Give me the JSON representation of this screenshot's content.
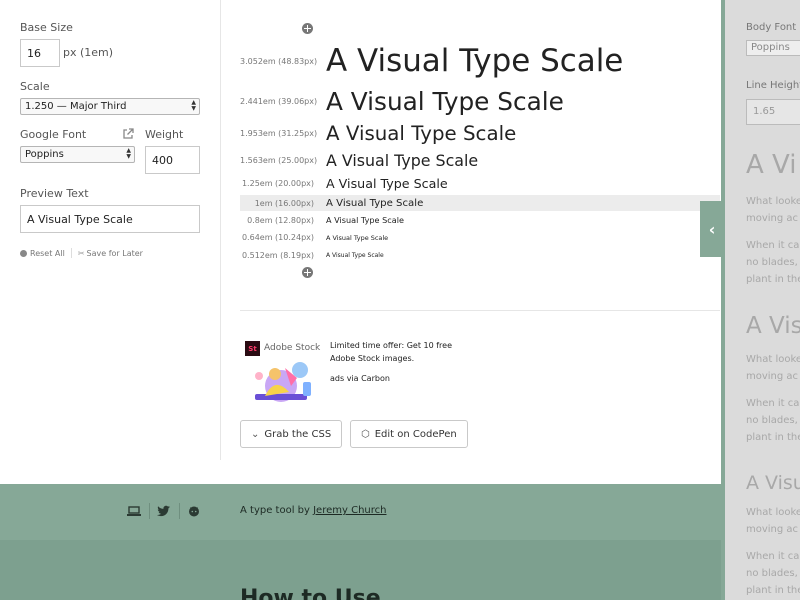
{
  "controls": {
    "base_size_label": "Base Size",
    "base_size_value": "16",
    "base_size_unit": "px (1em)",
    "scale_label": "Scale",
    "scale_value": "1.250 — Major Third",
    "google_font_label": "Google Font",
    "google_font_value": "Poppins",
    "weight_label": "Weight",
    "weight_value": "400",
    "preview_text_label": "Preview Text",
    "preview_text_value": "A Visual Type Scale",
    "reset_label": "Reset All",
    "save_label": "Save for Later"
  },
  "scale": {
    "sample_text": "A Visual Type Scale",
    "rows": [
      {
        "label": "3.052em (48.83px)",
        "em": 3.052
      },
      {
        "label": "2.441em (39.06px)",
        "em": 2.441
      },
      {
        "label": "1.953em (31.25px)",
        "em": 1.953
      },
      {
        "label": "1.563em (25.00px)",
        "em": 1.563
      },
      {
        "label": "1.25em (20.00px)",
        "em": 1.25
      },
      {
        "label": "1em (16.00px)",
        "em": 1
      },
      {
        "label": "0.8em (12.80px)",
        "em": 0.8
      },
      {
        "label": "0.64em (10.24px)",
        "em": 0.64
      },
      {
        "label": "0.512em (8.19px)",
        "em": 0.512
      }
    ]
  },
  "ad": {
    "logo_text": "St",
    "brand": "Adobe Stock",
    "text": "Limited time offer: Get 10 free Adobe Stock images.",
    "via": "ads via Carbon"
  },
  "buttons": {
    "grab_css": "Grab the CSS",
    "edit_codepen": "Edit on CodePen"
  },
  "footer": {
    "credit_prefix": "A type tool by",
    "credit_name": "Jeremy Church",
    "howto_heading": "How to Use"
  },
  "right_panel": {
    "body_font_label": "Body Font",
    "body_font_value": "Poppins",
    "line_height_label": "Line Height",
    "line_height_value": "1.65",
    "heading_1": "A Vi",
    "para_1a": "What looke\nmoving ac",
    "para_1b": "When it ca\nno blades,\nplant in the",
    "heading_2": "A Vis",
    "para_2a": "What looke\nmoving ac",
    "para_2b": "When it ca\nno blades,\nplant in the",
    "heading_3": "A Visu",
    "para_3a": "What looke\nmoving ac",
    "para_3b": "When it ca\nno blades,\nplant in the"
  },
  "colors": {
    "accent": "#86a897",
    "highlight_row": "#ececec"
  },
  "highlight_index": 5
}
